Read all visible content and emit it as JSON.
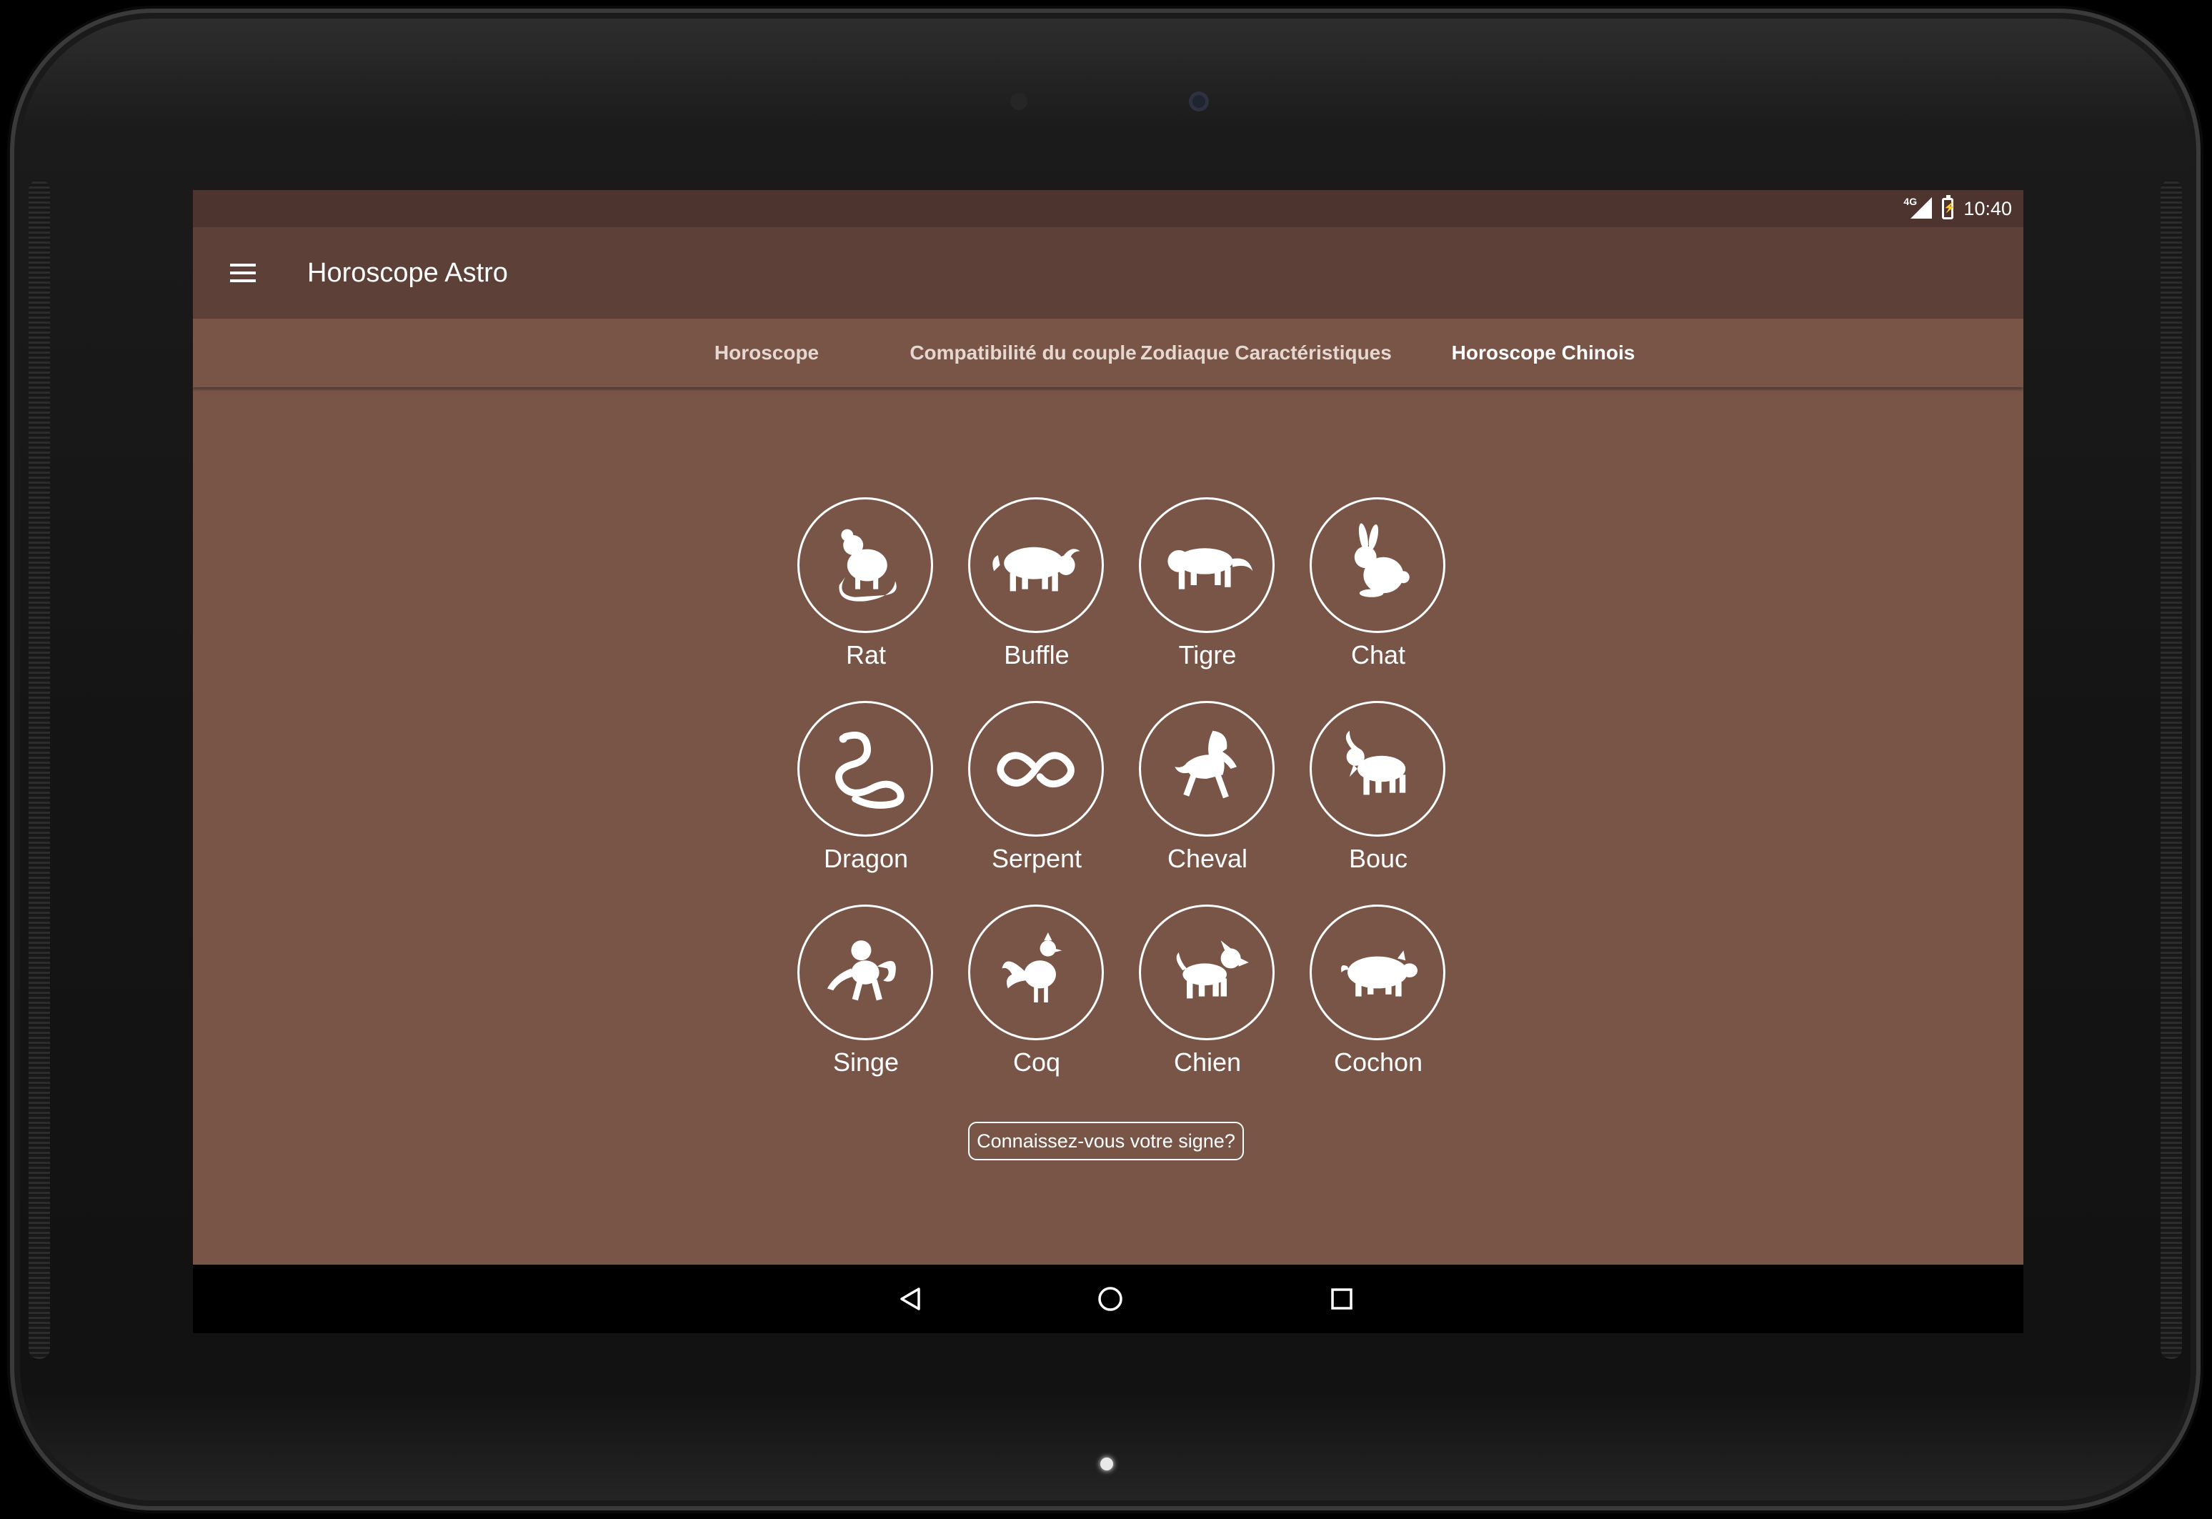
{
  "status_bar": {
    "network": "4G",
    "time": "10:40"
  },
  "toolbar": {
    "title": "Horoscope Astro"
  },
  "tabs": [
    {
      "label": "Horoscope",
      "selected": false
    },
    {
      "label": "Compatibilité du couple",
      "selected": false
    },
    {
      "label": "Zodiaque Caractéristiques",
      "selected": false
    },
    {
      "label": "Horoscope Chinois",
      "selected": true
    }
  ],
  "signs": [
    {
      "label": "Rat",
      "icon": "rat-icon"
    },
    {
      "label": "Buffle",
      "icon": "ox-icon"
    },
    {
      "label": "Tigre",
      "icon": "tiger-icon"
    },
    {
      "label": "Chat",
      "icon": "rabbit-icon"
    },
    {
      "label": "Dragon",
      "icon": "dragon-icon"
    },
    {
      "label": "Serpent",
      "icon": "snake-icon"
    },
    {
      "label": "Cheval",
      "icon": "horse-icon"
    },
    {
      "label": "Bouc",
      "icon": "goat-icon"
    },
    {
      "label": "Singe",
      "icon": "monkey-icon"
    },
    {
      "label": "Coq",
      "icon": "rooster-icon"
    },
    {
      "label": "Chien",
      "icon": "dog-icon"
    },
    {
      "label": "Cochon",
      "icon": "pig-icon"
    }
  ],
  "cta": {
    "label": "Connaissez-vous votre signe?"
  },
  "colors": {
    "status_bar": "#4e342e",
    "toolbar": "#5d4037",
    "content": "#795548",
    "nav_bar": "#000000",
    "icon": "#ffffff"
  }
}
